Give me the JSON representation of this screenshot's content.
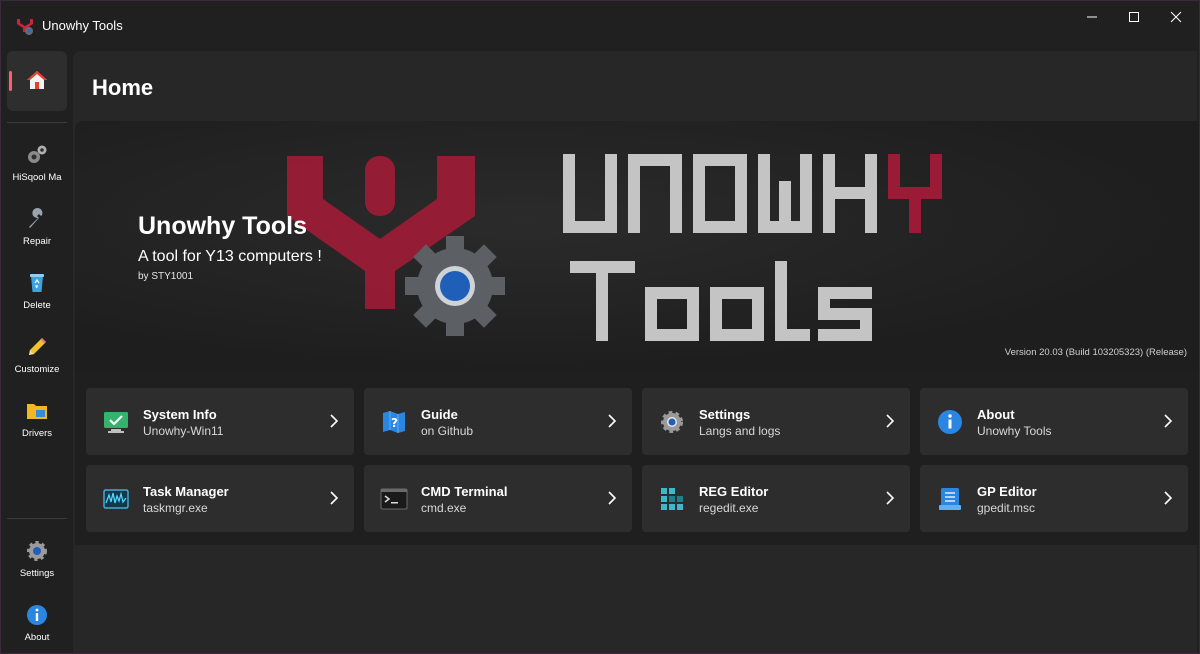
{
  "window": {
    "title": "Unowhy Tools",
    "controls": {
      "minimize": "—",
      "maximize": "☐",
      "close": "✕"
    }
  },
  "sidebar": {
    "items": [
      {
        "label": "",
        "icon": "home-icon",
        "active": true
      },
      {
        "label": "HiSqool Ma",
        "icon": "gears-icon"
      },
      {
        "label": "Repair",
        "icon": "wrench-icon"
      },
      {
        "label": "Delete",
        "icon": "recycle-bin-icon"
      },
      {
        "label": "Customize",
        "icon": "pencil-icon"
      },
      {
        "label": "Drivers",
        "icon": "drivers-folder-icon"
      }
    ],
    "footer": [
      {
        "label": "Settings",
        "icon": "gear-icon"
      },
      {
        "label": "About",
        "icon": "info-icon"
      }
    ]
  },
  "page": {
    "title": "Home"
  },
  "hero": {
    "title": "Unowhy Tools",
    "subtitle": "A tool for Y13 computers !",
    "author": "by STY1001",
    "version": "Version 20.03 (Build 103205323) (Release)",
    "logo_text_line1_a": "UNOWH",
    "logo_text_line1_b": "Y",
    "logo_text_line2": "Tools",
    "accent_color": "#9b1b36"
  },
  "cards": [
    {
      "title": "System Info",
      "subtitle": "Unowhy-Win11",
      "icon": "system-info-icon"
    },
    {
      "title": "Guide",
      "subtitle": "on Github",
      "icon": "guide-map-icon"
    },
    {
      "title": "Settings",
      "subtitle": "Langs and logs",
      "icon": "settings-gear-icon"
    },
    {
      "title": "About",
      "subtitle": "Unowhy Tools",
      "icon": "about-info-icon"
    },
    {
      "title": "Task Manager",
      "subtitle": "taskmgr.exe",
      "icon": "task-manager-icon"
    },
    {
      "title": "CMD Terminal",
      "subtitle": "cmd.exe",
      "icon": "terminal-icon"
    },
    {
      "title": "REG Editor",
      "subtitle": "regedit.exe",
      "icon": "registry-icon"
    },
    {
      "title": "GP Editor",
      "subtitle": "gpedit.msc",
      "icon": "group-policy-icon"
    }
  ]
}
